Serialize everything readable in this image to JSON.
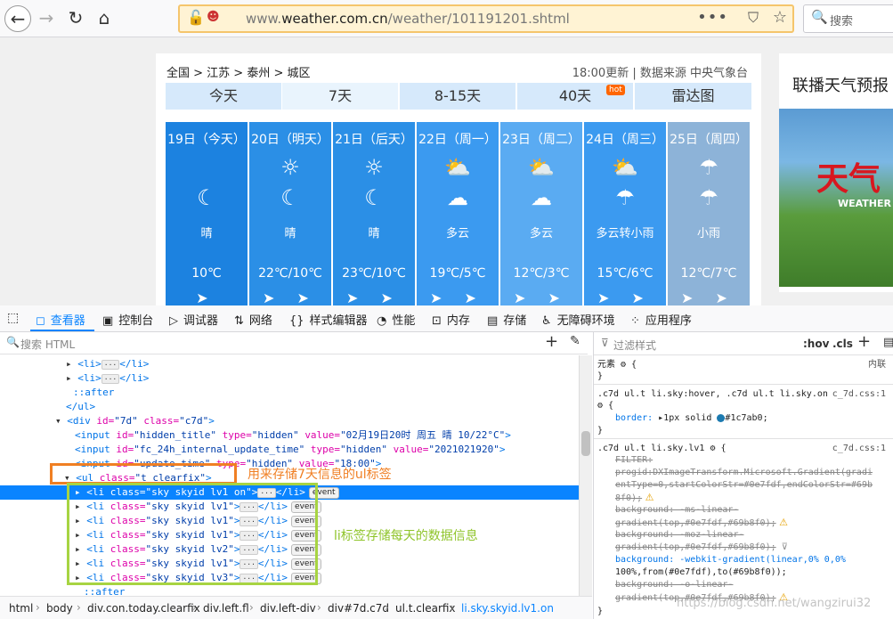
{
  "browser": {
    "url_prefix": "www.",
    "url_host": "weather.com.cn",
    "url_path": "/weather/101191201.shtml",
    "search_placeholder": "搜索"
  },
  "weather": {
    "breadcrumb": "全国 > 江苏 > 泰州 > 城区",
    "update_time": "18:00更新",
    "source": "数据来源 中央气象台",
    "tabs": [
      {
        "label": "今天"
      },
      {
        "label": "7天"
      },
      {
        "label": "8-15天"
      },
      {
        "label": "40天",
        "badge": "hot"
      },
      {
        "label": "雷达图"
      }
    ],
    "days": [
      {
        "date": "19日（今天）",
        "icon1": "",
        "icon2": "☾",
        "desc": "晴",
        "temp": "10℃",
        "wind": "➤",
        "color": "#1c82e0"
      },
      {
        "date": "20日（明天）",
        "icon1": "☼",
        "icon2": "☾",
        "desc": "晴",
        "temp": "22℃/10℃",
        "wind": "➤ ➤",
        "color": "#2b8fe6"
      },
      {
        "date": "21日（后天）",
        "icon1": "☼",
        "icon2": "☾",
        "desc": "晴",
        "temp": "23℃/10℃",
        "wind": "➤ ➤",
        "color": "#2b8fe6"
      },
      {
        "date": "22日（周一）",
        "icon1": "⛅",
        "icon2": "☁",
        "desc": "多云",
        "temp": "19℃/5℃",
        "wind": "➤ ➤",
        "color": "#3b9af0"
      },
      {
        "date": "23日（周二）",
        "icon1": "⛅",
        "icon2": "☁",
        "desc": "多云",
        "temp": "12℃/3℃",
        "wind": "➤ ➤",
        "color": "#5aabf2"
      },
      {
        "date": "24日（周三）",
        "icon1": "⛅",
        "icon2": "☂",
        "desc": "多云转小雨",
        "temp": "15℃/6℃",
        "wind": "➤ ➤",
        "color": "#3b9af0"
      },
      {
        "date": "25日（周四）",
        "icon1": "☂",
        "icon2": "☂",
        "desc": "小雨",
        "temp": "12℃/7℃",
        "wind": "➤ ➤",
        "color": "#8db3d8"
      }
    ],
    "ad_title": "联播天气预报",
    "ad_logo": "天气",
    "ad_logo_sub": "WEATHER"
  },
  "devtools": {
    "tabs": [
      "查看器",
      "控制台",
      "调试器",
      "网络",
      "样式编辑器",
      "性能",
      "内存",
      "存储",
      "无障碍环境",
      "应用程序"
    ],
    "html_search_placeholder": "搜索 HTML",
    "tree": [
      {
        "indent": 74,
        "parts": [
          [
            "tw",
            "▸ "
          ],
          [
            "tg",
            "<li>"
          ],
          [
            "dots",
            "···"
          ],
          [
            "tg",
            "</li>"
          ]
        ]
      },
      {
        "indent": 74,
        "parts": [
          [
            "tw",
            "▸ "
          ],
          [
            "tg",
            "<li>"
          ],
          [
            "dots",
            "···"
          ],
          [
            "tg",
            "</li>"
          ]
        ]
      },
      {
        "indent": 82,
        "parts": [
          [
            "ps",
            "::after"
          ]
        ]
      },
      {
        "indent": 74,
        "parts": [
          [
            "tg",
            "</ul>"
          ]
        ]
      },
      {
        "indent": 62,
        "parts": [
          [
            "tw",
            "▾ "
          ],
          [
            "tg",
            "<div "
          ],
          [
            "at",
            "id="
          ],
          [
            "av",
            "\"7d\" "
          ],
          [
            "at",
            "class="
          ],
          [
            "av",
            "\"c7d\""
          ],
          [
            "tg",
            ">"
          ]
        ]
      },
      {
        "indent": 84,
        "parts": [
          [
            "tg",
            "<input "
          ],
          [
            "at",
            "id="
          ],
          [
            "av",
            "\"hidden_title\" "
          ],
          [
            "at",
            "type="
          ],
          [
            "av",
            "\"hidden\" "
          ],
          [
            "at",
            "value="
          ],
          [
            "av",
            "\"02月19日20时 周五 晴 10/22°C\""
          ],
          [
            "tg",
            ">"
          ]
        ]
      },
      {
        "indent": 84,
        "parts": [
          [
            "tg",
            "<input "
          ],
          [
            "at",
            "id="
          ],
          [
            "av",
            "\"fc_24h_internal_update_time\" "
          ],
          [
            "at",
            "type="
          ],
          [
            "av",
            "\"hidden\" "
          ],
          [
            "at",
            "value="
          ],
          [
            "av",
            "\"2021021920\""
          ],
          [
            "tg",
            ">"
          ]
        ]
      },
      {
        "indent": 84,
        "parts": [
          [
            "tg",
            "<input "
          ],
          [
            "at",
            "id="
          ],
          [
            "av",
            "\"update_time\" "
          ],
          [
            "at",
            "type="
          ],
          [
            "av",
            "\"hidden\" "
          ],
          [
            "at",
            "value="
          ],
          [
            "av",
            "\"18:00\""
          ],
          [
            "tg",
            ">"
          ]
        ]
      },
      {
        "indent": 72,
        "parts": [
          [
            "tw",
            "▾ "
          ],
          [
            "tg",
            "<ul "
          ],
          [
            "at",
            "class="
          ],
          [
            "av",
            "\"t clearfix\""
          ],
          [
            "tg",
            ">"
          ]
        ]
      },
      {
        "indent": 84,
        "sel": true,
        "parts": [
          [
            "tw",
            "▸ "
          ],
          [
            "tg",
            "<li "
          ],
          [
            "at",
            "class="
          ],
          [
            "av",
            "\"sky skyid lv1 on\""
          ],
          [
            "tg",
            ">"
          ],
          [
            "dots",
            "···"
          ],
          [
            "tg",
            "</li>"
          ],
          [
            "ev",
            "event"
          ]
        ]
      },
      {
        "indent": 84,
        "parts": [
          [
            "tw",
            "▸ "
          ],
          [
            "tg",
            "<li "
          ],
          [
            "at",
            "class="
          ],
          [
            "av",
            "\"sky skyid lv1\""
          ],
          [
            "tg",
            ">"
          ],
          [
            "dots",
            "···"
          ],
          [
            "tg",
            "</li>"
          ],
          [
            "ev",
            "event"
          ]
        ]
      },
      {
        "indent": 84,
        "parts": [
          [
            "tw",
            "▸ "
          ],
          [
            "tg",
            "<li "
          ],
          [
            "at",
            "class="
          ],
          [
            "av",
            "\"sky skyid lv1\""
          ],
          [
            "tg",
            ">"
          ],
          [
            "dots",
            "···"
          ],
          [
            "tg",
            "</li>"
          ],
          [
            "ev",
            "event"
          ]
        ]
      },
      {
        "indent": 84,
        "parts": [
          [
            "tw",
            "▸ "
          ],
          [
            "tg",
            "<li "
          ],
          [
            "at",
            "class="
          ],
          [
            "av",
            "\"sky skyid lv1\""
          ],
          [
            "tg",
            ">"
          ],
          [
            "dots",
            "···"
          ],
          [
            "tg",
            "</li>"
          ],
          [
            "ev",
            "event"
          ]
        ]
      },
      {
        "indent": 84,
        "parts": [
          [
            "tw",
            "▸ "
          ],
          [
            "tg",
            "<li "
          ],
          [
            "at",
            "class="
          ],
          [
            "av",
            "\"sky skyid lv2\""
          ],
          [
            "tg",
            ">"
          ],
          [
            "dots",
            "···"
          ],
          [
            "tg",
            "</li>"
          ],
          [
            "ev",
            "event"
          ]
        ]
      },
      {
        "indent": 84,
        "parts": [
          [
            "tw",
            "▸ "
          ],
          [
            "tg",
            "<li "
          ],
          [
            "at",
            "class="
          ],
          [
            "av",
            "\"sky skyid lv1\""
          ],
          [
            "tg",
            ">"
          ],
          [
            "dots",
            "···"
          ],
          [
            "tg",
            "</li>"
          ],
          [
            "ev",
            "event"
          ]
        ]
      },
      {
        "indent": 84,
        "parts": [
          [
            "tw",
            "▸ "
          ],
          [
            "tg",
            "<li "
          ],
          [
            "at",
            "class="
          ],
          [
            "av",
            "\"sky skyid lv3\""
          ],
          [
            "tg",
            ">"
          ],
          [
            "dots",
            "···"
          ],
          [
            "tg",
            "</li>"
          ],
          [
            "ev",
            "event"
          ]
        ]
      },
      {
        "indent": 94,
        "parts": [
          [
            "ps",
            "::after"
          ]
        ]
      }
    ],
    "annotation_ul": "用来存储7天信息的ul标签",
    "annotation_li": "li标签存储每天的数据信息",
    "breadcrumbs": [
      "html",
      "body",
      "div.con.today.clearfix",
      "div.left.fl",
      "div.left-div",
      "div#7d.c7d",
      "ul.t.clearfix",
      "li.sky.skyid.lv1.on"
    ],
    "rules": {
      "filter_placeholder": "过滤样式",
      "hov": ":hov",
      "cls": ".cls",
      "element_label": "元素",
      "inline_label": "内联",
      "rule1_selector": ".c7d ul.t li.sky:hover, .c7d ul.t li.sky.on",
      "rule1_source": "c_7d.css:1",
      "rule1_prop": "border:",
      "rule1_value": "1px solid",
      "rule1_color": "#1c7ab0",
      "rule2_selector": ".c7d ul.t li.sky.lv1",
      "rule2_source": "c_7d.css:1",
      "rule2_lines": [
        "FILTER:",
        "   progid:DXImageTransform.Microsoft.Gradient(gradi",
        "   entType=0,startColorStr=#0e7fdf,endColorStr=#69b",
        "   8f0);",
        "background: -ms-linear-",
        "   gradient(top,#0e7fdf,#69b8f0);",
        "background: -moz-linear-",
        "   gradient(top,#0e7fdf,#69b8f0);",
        "background: -webkit-gradient(linear,0% 0,0%",
        "   100%,from(#0e7fdf),to(#69b8f0));",
        "background: -o-linear-",
        "   gradient(top,#0e7fdf,#69b8f0);"
      ]
    }
  },
  "watermark": "https://blog.csdn.net/wangzirui32"
}
